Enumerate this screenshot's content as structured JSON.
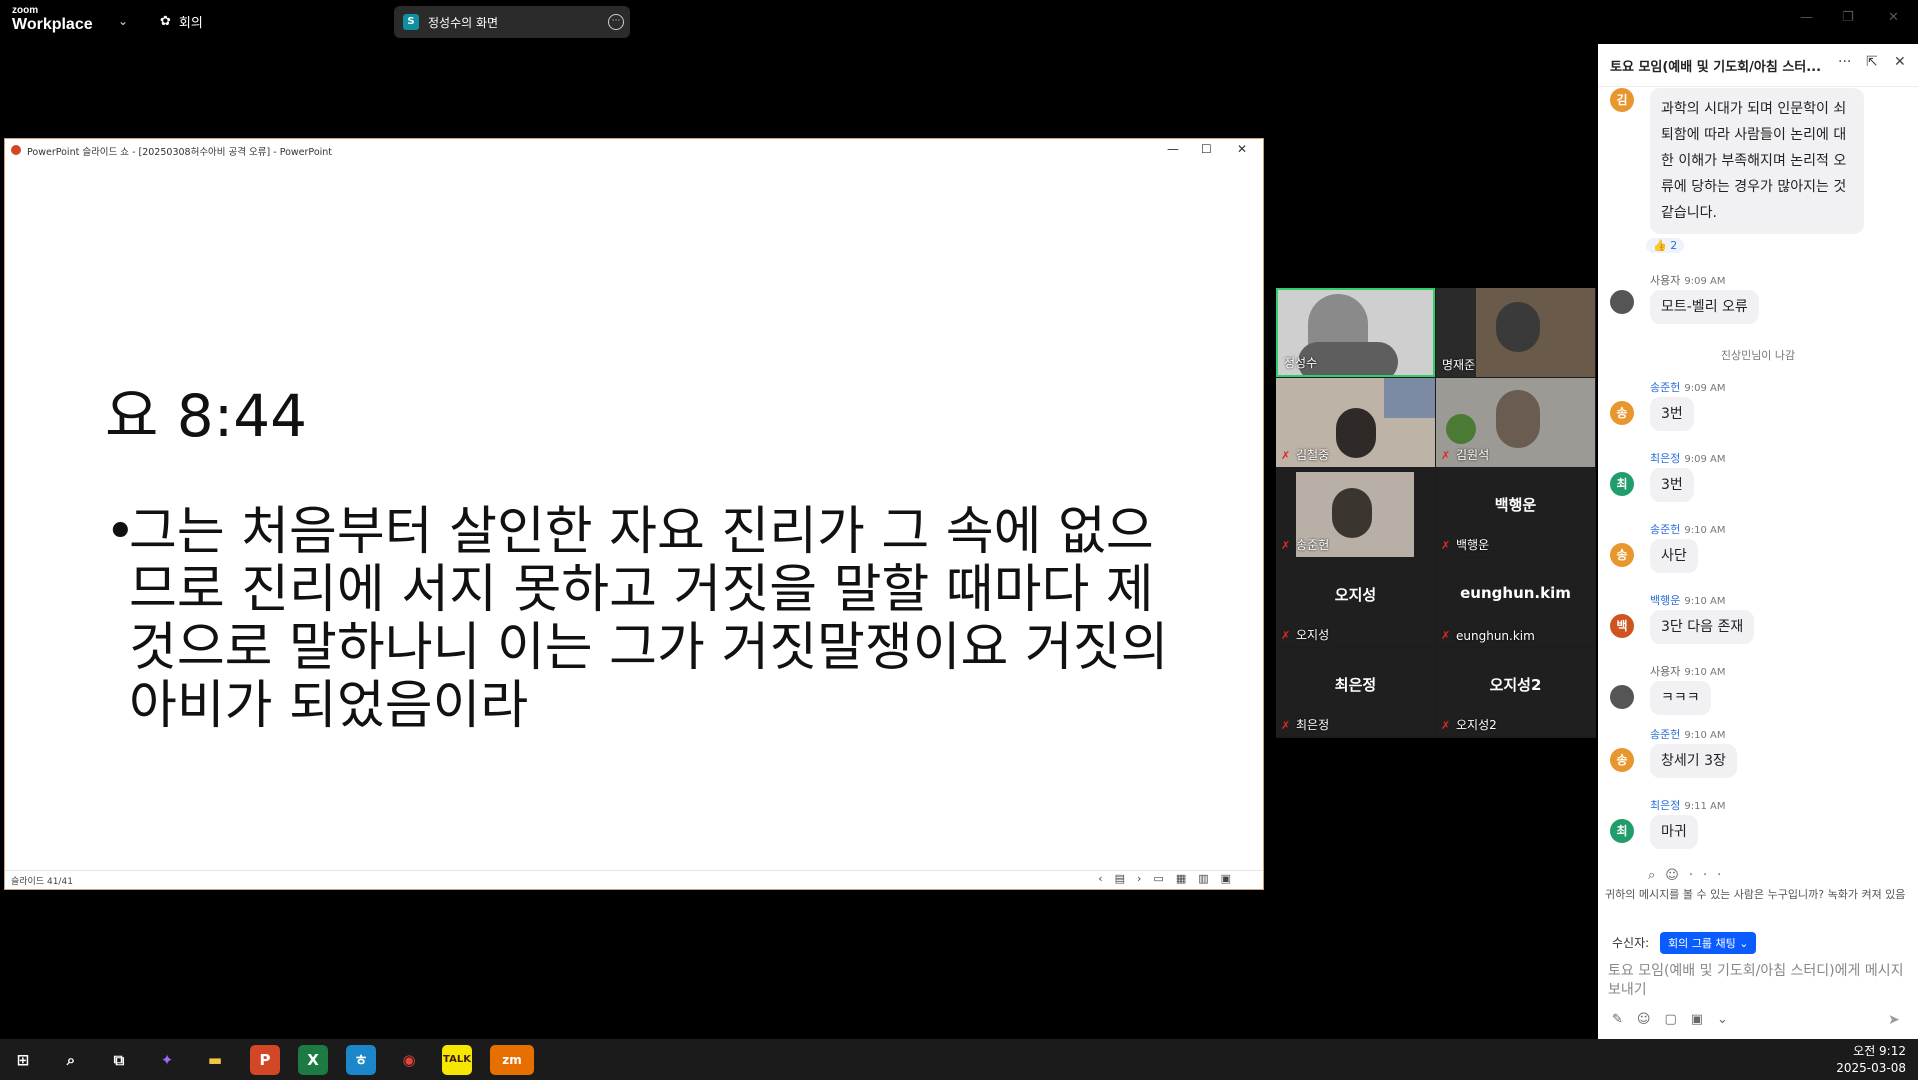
{
  "app": {
    "logo_small": "zoom",
    "logo_big": "Workplace",
    "meeting_menu": "회의",
    "share_label": "정성수의 화면",
    "share_badge": "S"
  },
  "ppt": {
    "title": "PowerPoint 슬라이드 쇼 - [20250308허수아비 공격 오류] - PowerPoint",
    "slide_title": "요 8:44",
    "slide_bullet": "그는 처음부터 살인한 자요 진리가 그 속에 없으므로 진리에 서지 못하고 거짓을 말할 때마다 제 것으로 말하나니 이는 그가 거짓말쟁이요 거짓의 아비가 되었음이라",
    "status": "슬라이드 41/41"
  },
  "gallery": {
    "tiles": [
      {
        "name": "정성수",
        "video": true
      },
      {
        "name": "명재준",
        "video": true
      },
      {
        "name": "김철중",
        "video": true
      },
      {
        "name": "김원석",
        "video": true
      },
      {
        "name": "송준헌",
        "video": true
      },
      {
        "name": "백행운",
        "big": "백행운"
      },
      {
        "name": "오지성",
        "big": "오지성"
      },
      {
        "name": "eunghun.kim",
        "big": "eunghun.kim"
      },
      {
        "name": "최은정",
        "big": "최은정"
      },
      {
        "name": "오지성2",
        "big": "오지성2"
      }
    ]
  },
  "chat": {
    "header": "토요 모임(예배 및 기도회/아침 스터...",
    "messages": [
      {
        "avatar": "김",
        "color": "#e8962e",
        "text": "과학의 시대가 되며 인문학이 쇠퇴함에 따라 사람들이 논리에 대한 이해가 부족해지며 논리적 오류에 당하는 경우가 많아지는 것 같습니다."
      },
      {
        "sender": "사용자",
        "time": "9:09 AM",
        "text": "모트-벨리 오류"
      },
      {
        "sender": "송준헌",
        "time": "9:09 AM",
        "avatar": "송",
        "color": "#e8962e",
        "text": "3번"
      },
      {
        "sender": "최은정",
        "time": "9:09 AM",
        "avatar": "최",
        "color": "#1f9d6b",
        "text": "3번"
      },
      {
        "sender": "송준헌",
        "time": "9:10 AM",
        "avatar": "송",
        "color": "#e8962e",
        "text": "사단"
      },
      {
        "sender": "백행운",
        "time": "9:10 AM",
        "avatar": "백",
        "color": "#d0541f",
        "text": "3단 다음 존재"
      },
      {
        "sender": "사용자",
        "time": "9:10 AM",
        "text": "ㅋㅋㅋ"
      },
      {
        "sender": "송준헌",
        "time": "9:10 AM",
        "avatar": "송",
        "color": "#e8962e",
        "text": "창세기 3장"
      },
      {
        "sender": "최은정",
        "time": "9:11 AM",
        "avatar": "최",
        "color": "#1f9d6b",
        "text": "마귀"
      }
    ],
    "reaction": "👍 2",
    "system_msg": "진상민님이 나감",
    "privacy": "귀하의 메시지를 볼 수 있는 사람은 누구입니까? 녹화가 켜져 있음",
    "to_label": "수신자:",
    "to_value": "회의 그룹 채팅 ⌄",
    "input_placeholder": "토요 모임(예배 및 기도회/아침 스터디)에게 메시지 보내기"
  },
  "taskbar": {
    "time": "오전 9:12",
    "date": "2025-03-08"
  }
}
